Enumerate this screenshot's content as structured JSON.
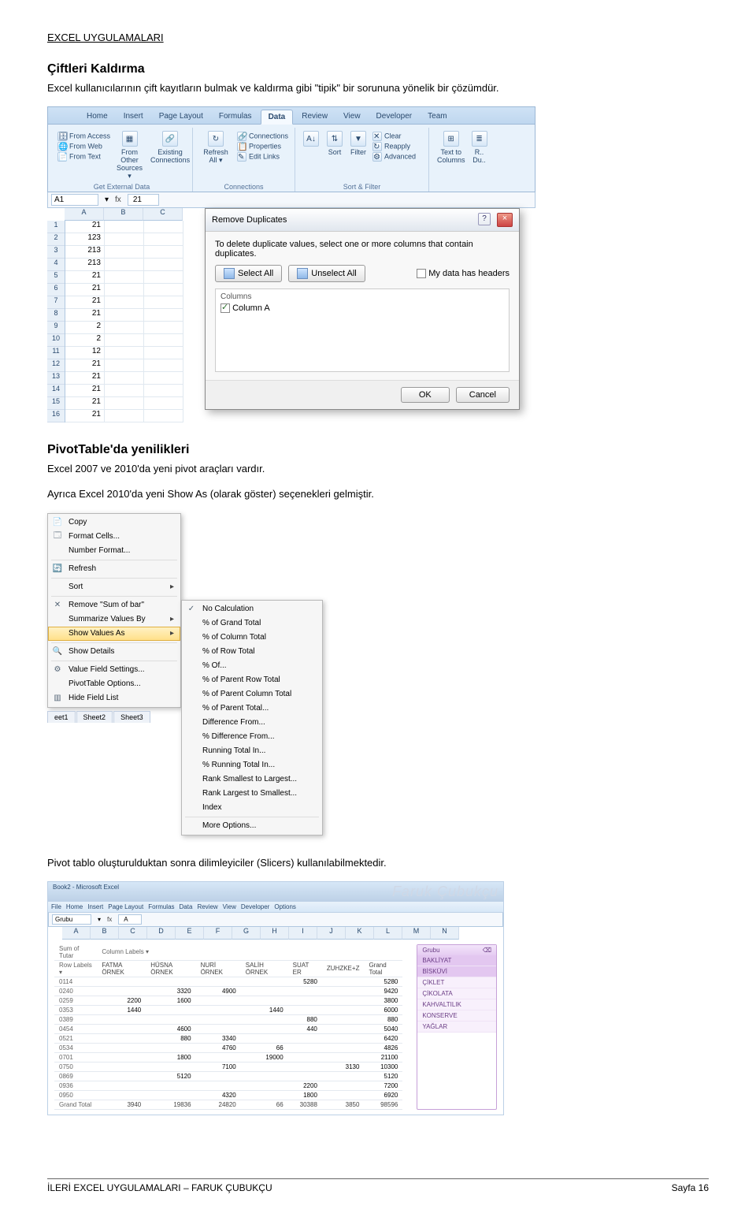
{
  "page": {
    "header": "EXCEL UYGULAMALARI",
    "footer_left": "İLERİ EXCEL UYGULAMALARI – FARUK ÇUBUKÇU",
    "footer_right": "Sayfa 16"
  },
  "section1": {
    "title": "Çiftleri Kaldırma",
    "text": "Excel kullanıcılarının çift kayıtların bulmak ve kaldırma gibi \"tipik\" bir sorununa yönelik bir çözümdür."
  },
  "section2": {
    "title": "PivotTable'da yenilikleri",
    "text1": "Excel 2007 ve 2010'da yeni pivot araçları vardır.",
    "text2": "Ayrıca Excel 2010'da yeni Show As (olarak göster) seçenekleri gelmiştir.",
    "text3": "Pivot tablo oluşturulduktan sonra dilimleyiciler (Slicers) kullanılabilmektedir."
  },
  "fig1": {
    "tabs": [
      "Home",
      "Insert",
      "Page Layout",
      "Formulas",
      "Data",
      "Review",
      "View",
      "Developer",
      "Team"
    ],
    "active_tab": "Data",
    "groups": {
      "external": {
        "label": "Get External Data",
        "items_left": [
          "From Access",
          "From Web",
          "From Text"
        ],
        "from_other": "From Other Sources",
        "existing": "Existing Connections"
      },
      "connections": {
        "label": "Connections",
        "refresh": "Refresh All",
        "items": [
          "Connections",
          "Properties",
          "Edit Links"
        ]
      },
      "sortfilter": {
        "label": "Sort & Filter",
        "sort": "Sort",
        "filter": "Filter",
        "items": [
          "Clear",
          "Reapply",
          "Advanced"
        ]
      },
      "datatools": {
        "label": "",
        "text_to_cols": "Text to Columns",
        "remove_dup": "R.. Du.."
      }
    },
    "namebox": "A1",
    "fx": "fx",
    "fval": "21",
    "col_headers": [
      "A",
      "B",
      "C"
    ],
    "row_headers": [
      "1",
      "2",
      "3",
      "4",
      "5",
      "6",
      "7",
      "8",
      "9",
      "10",
      "11",
      "12",
      "13",
      "14",
      "15",
      "16"
    ],
    "colA": [
      "21",
      "123",
      "213",
      "213",
      "21",
      "21",
      "21",
      "21",
      "2",
      "2",
      "12",
      "21",
      "21",
      "21",
      "21",
      "21"
    ],
    "dialog": {
      "title": "Remove Duplicates",
      "desc": "To delete duplicate values, select one or more columns that contain duplicates.",
      "select_all": "Select All",
      "unselect_all": "Unselect All",
      "headers_cb": "My data has headers",
      "columns_label": "Columns",
      "col_item": "Column A",
      "ok": "OK",
      "cancel": "Cancel"
    }
  },
  "fig2": {
    "main": [
      {
        "label": "Copy",
        "ico": "📄"
      },
      {
        "label": "Format Cells...",
        "ico": "🗔"
      },
      {
        "label": "Number Format...",
        "ico": ""
      },
      {
        "sep": true
      },
      {
        "label": "Refresh",
        "ico": "🔄"
      },
      {
        "sep": true
      },
      {
        "label": "Sort",
        "ico": "",
        "arrow": true
      },
      {
        "sep": true
      },
      {
        "label": "Remove \"Sum of bar\"",
        "ico": "✕"
      },
      {
        "label": "Summarize Values By",
        "ico": "",
        "arrow": true
      },
      {
        "label": "Show Values As",
        "ico": "",
        "arrow": true,
        "hover": true
      },
      {
        "sep": true
      },
      {
        "label": "Show Details",
        "ico": "🔍"
      },
      {
        "sep": true
      },
      {
        "label": "Value Field Settings...",
        "ico": "⚙"
      },
      {
        "label": "PivotTable Options...",
        "ico": ""
      },
      {
        "label": "Hide Field List",
        "ico": "▥"
      }
    ],
    "sub": [
      {
        "label": "No Calculation",
        "checked": true
      },
      {
        "label": "% of Grand Total"
      },
      {
        "label": "% of Column Total"
      },
      {
        "label": "% of Row Total"
      },
      {
        "label": "% Of..."
      },
      {
        "label": "% of Parent Row Total"
      },
      {
        "label": "% of Parent Column Total"
      },
      {
        "label": "% of Parent Total..."
      },
      {
        "label": "Difference From..."
      },
      {
        "label": "% Difference From..."
      },
      {
        "label": "Running Total In..."
      },
      {
        "label": "% Running Total In..."
      },
      {
        "label": "Rank Smallest to Largest..."
      },
      {
        "label": "Rank Largest to Smallest..."
      },
      {
        "label": "Index"
      },
      {
        "sep": true
      },
      {
        "label": "More Options..."
      }
    ],
    "sheets": [
      "eet1",
      "Sheet2",
      "Sheet3"
    ]
  },
  "fig3": {
    "title": "Book2 - Microsoft Excel",
    "watermark": "Faruk Çubukçu",
    "tabs": [
      "File",
      "Home",
      "Insert",
      "Page Layout",
      "Formulas",
      "Data",
      "Review",
      "View",
      "Developer",
      "Options"
    ],
    "namebox": "Grubu",
    "fval": "A",
    "col_letters": [
      "A",
      "B",
      "C",
      "D",
      "E",
      "F",
      "G",
      "H",
      "I",
      "J",
      "K",
      "L",
      "M",
      "N"
    ],
    "pivot": {
      "sum_of": "Sum of Tutar",
      "col_labels": "Column Labels",
      "row_labels": "Row Labels",
      "grubu": "Grubu",
      "cols": [
        "FATMA ÖRNEK",
        "HÜSNA ÖRNEK",
        "NURİ ÖRNEK",
        "SALİH ÖRNEK",
        "SUAT ER",
        "ZUHZKE+Z",
        "Grand Total"
      ],
      "rows": [
        {
          "r": "0114",
          "v": [
            "",
            "",
            "",
            "",
            "5280",
            "",
            "5280"
          ]
        },
        {
          "r": "0240",
          "v": [
            "",
            "3320",
            "4900",
            "",
            "",
            "",
            "9420"
          ]
        },
        {
          "r": "0259",
          "v": [
            "2200",
            "1600",
            "",
            "",
            "",
            "",
            "3800"
          ]
        },
        {
          "r": "0353",
          "v": [
            "1440",
            "",
            "",
            "1440",
            "",
            "",
            "6000"
          ]
        },
        {
          "r": "0389",
          "v": [
            "",
            "",
            "",
            "",
            "880",
            "",
            "880"
          ]
        },
        {
          "r": "0454",
          "v": [
            "",
            "4600",
            "",
            "",
            "440",
            "",
            "5040"
          ]
        },
        {
          "r": "0521",
          "v": [
            "",
            "880",
            "3340",
            "",
            "",
            "",
            "6420"
          ]
        },
        {
          "r": "0534",
          "v": [
            "",
            "",
            "4760",
            "66",
            "",
            "",
            "4826"
          ]
        },
        {
          "r": "0701",
          "v": [
            "",
            "1800",
            "",
            "19000",
            "",
            "",
            "21100"
          ]
        },
        {
          "r": "0750",
          "v": [
            "",
            "",
            "7100",
            "",
            "",
            "3130",
            "10300"
          ]
        },
        {
          "r": "0869",
          "v": [
            "",
            "5120",
            "",
            "",
            "",
            "",
            "5120"
          ]
        },
        {
          "r": "0936",
          "v": [
            "",
            "",
            "",
            "",
            "2200",
            "",
            "7200"
          ]
        },
        {
          "r": "0950",
          "v": [
            "",
            "",
            "4320",
            "",
            "1800",
            "",
            "6920"
          ]
        }
      ],
      "grand_label": "Grand Total",
      "grand": [
        "3940",
        "19836",
        "24820",
        "66",
        "30388",
        "3850",
        "98596"
      ]
    },
    "slicer": {
      "title": "Grubu",
      "items": [
        "BAKLİYAT",
        "BİSKÜVİ",
        "ÇİKLET",
        "ÇİKOLATA",
        "KAHVALTILIK",
        "KONSERVE",
        "YAĞLAR"
      ]
    }
  }
}
